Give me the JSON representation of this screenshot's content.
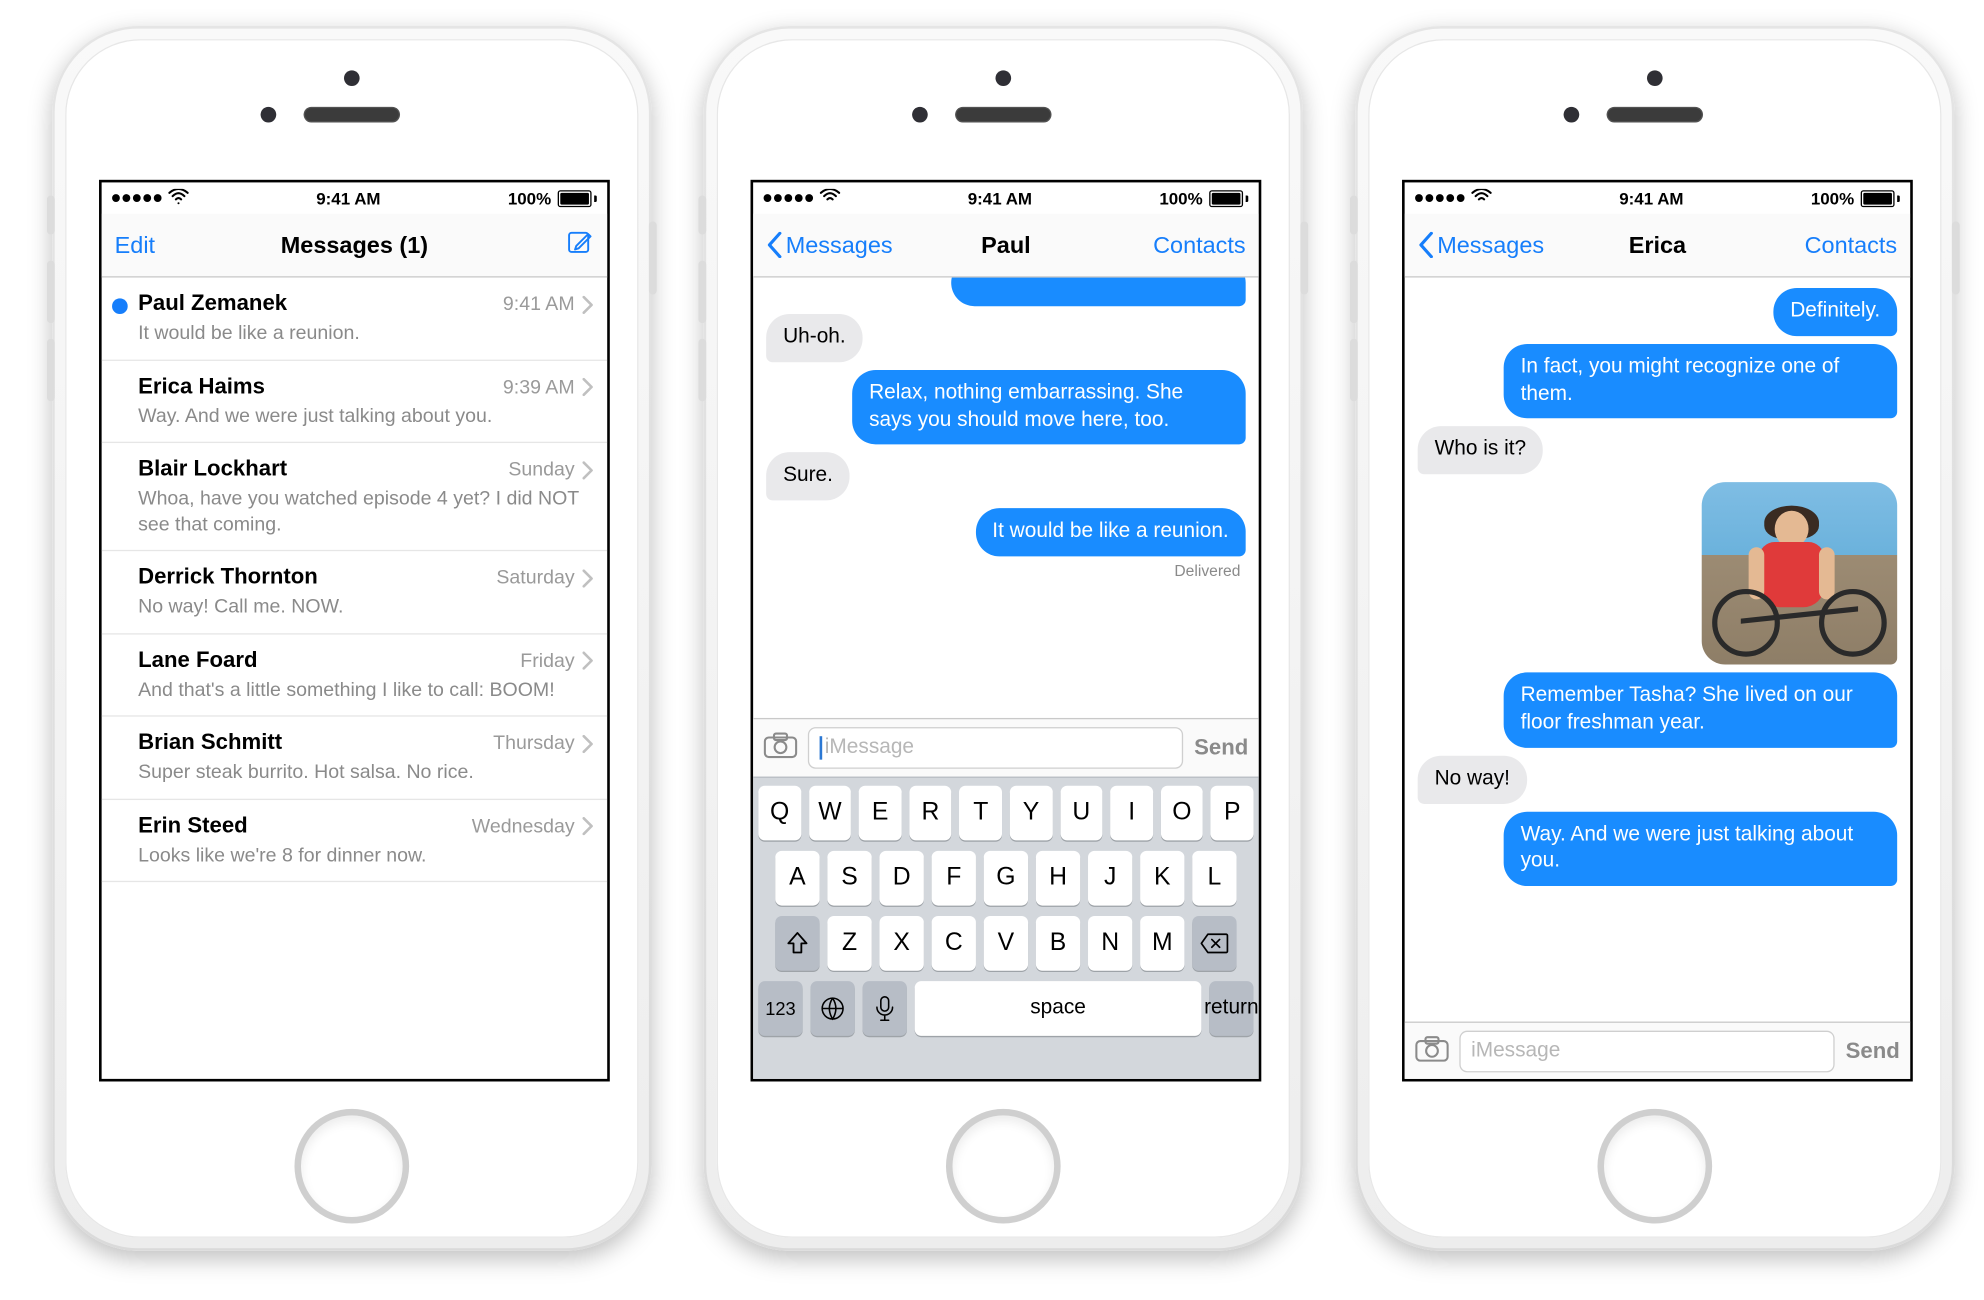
{
  "status": {
    "time": "9:41 AM",
    "battery_pct": "100%"
  },
  "phone1": {
    "nav": {
      "left": "Edit",
      "title": "Messages (1)"
    },
    "rows": [
      {
        "name": "Paul Zemanek",
        "ts": "9:41 AM",
        "preview": "It would be like a reunion.",
        "unread": true
      },
      {
        "name": "Erica Haims",
        "ts": "9:39 AM",
        "preview": "Way. And we were just talking about you.",
        "unread": false
      },
      {
        "name": "Blair Lockhart",
        "ts": "Sunday",
        "preview": "Whoa, have you watched episode 4 yet? I did NOT see that coming.",
        "unread": false
      },
      {
        "name": "Derrick Thornton",
        "ts": "Saturday",
        "preview": "No way! Call me. NOW.",
        "unread": false
      },
      {
        "name": "Lane Foard",
        "ts": "Friday",
        "preview": "And that's a little something I like to call: BOOM!",
        "unread": false
      },
      {
        "name": "Brian Schmitt",
        "ts": "Thursday",
        "preview": "Super steak burrito. Hot salsa. No rice.",
        "unread": false
      },
      {
        "name": "Erin Steed",
        "ts": "Wednesday",
        "preview": "Looks like we're 8 for dinner now.",
        "unread": false
      }
    ]
  },
  "phone2": {
    "nav": {
      "back": "Messages",
      "title": "Paul",
      "right": "Contacts"
    },
    "messages": [
      {
        "side": "rcvd",
        "text": "Uh-oh."
      },
      {
        "side": "sent",
        "text": "Relax, nothing embarrassing. She says you should move here, too."
      },
      {
        "side": "rcvd",
        "text": "Sure."
      },
      {
        "side": "sent",
        "text": "It would be like a reunion."
      }
    ],
    "delivered": "Delivered",
    "input_placeholder": "iMessage",
    "send_label": "Send",
    "keyboard": {
      "row1": [
        "Q",
        "W",
        "E",
        "R",
        "T",
        "Y",
        "U",
        "I",
        "O",
        "P"
      ],
      "row2": [
        "A",
        "S",
        "D",
        "F",
        "G",
        "H",
        "J",
        "K",
        "L"
      ],
      "row3": [
        "Z",
        "X",
        "C",
        "V",
        "B",
        "N",
        "M"
      ],
      "mode": "123",
      "space": "space",
      "ret": "return"
    }
  },
  "phone3": {
    "nav": {
      "back": "Messages",
      "title": "Erica",
      "right": "Contacts"
    },
    "messages": [
      {
        "side": "sent",
        "text": "Definitely."
      },
      {
        "side": "sent",
        "text": "In fact, you might recognize one of them."
      },
      {
        "side": "rcvd",
        "text": "Who is it?"
      },
      {
        "side": "image"
      },
      {
        "side": "sent",
        "text": "Remember Tasha? She lived on our floor freshman year."
      },
      {
        "side": "rcvd",
        "text": "No way!"
      },
      {
        "side": "sent",
        "text": "Way. And we were just talking about you."
      }
    ],
    "input_placeholder": "iMessage",
    "send_label": "Send"
  }
}
